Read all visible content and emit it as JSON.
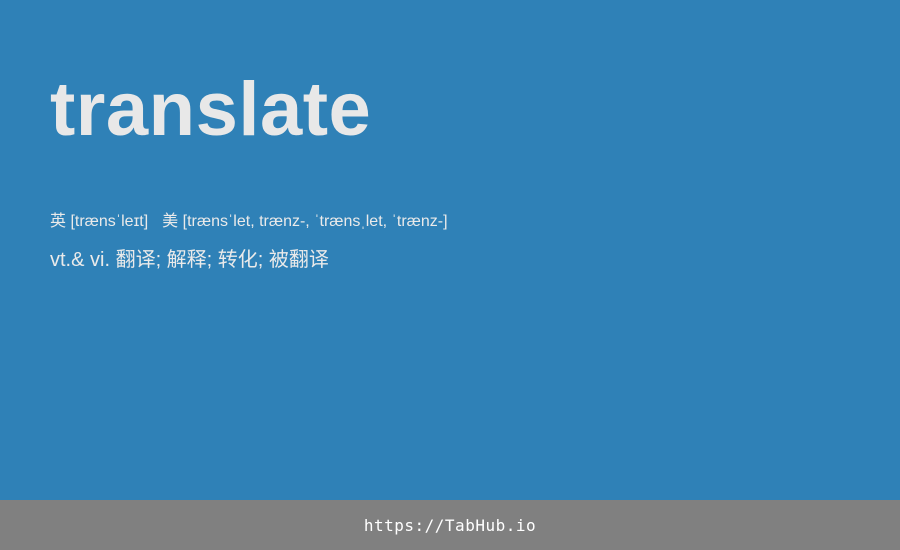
{
  "entry": {
    "word": "translate",
    "phonetic_uk": "英 [trænsˈleɪt]",
    "phonetic_us": "美 [trænsˈlet, trænz-, ˈtrænsˌlet, ˈtrænz-]",
    "definition": "vt.& vi. 翻译; 解释; 转化; 被翻译"
  },
  "footer": {
    "link_text": "https://TabHub.io"
  },
  "colors": {
    "background": "#2f81b7",
    "footer_background": "#808080",
    "text": "#e8e8e8"
  }
}
